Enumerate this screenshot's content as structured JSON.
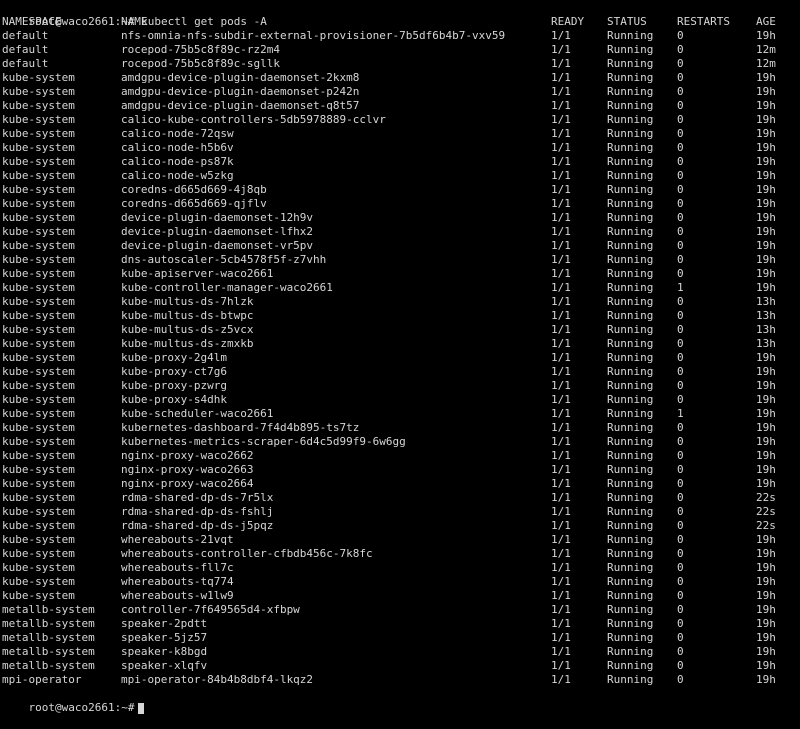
{
  "terminal": {
    "prompt_command": "root@waco2661:~# kubectl get pods -A",
    "final_prompt": "root@waco2661:~#",
    "headers": {
      "namespace": "NAMESPACE",
      "name": "NAME",
      "ready": "READY",
      "status": "STATUS",
      "restarts": "RESTARTS",
      "age": "AGE"
    },
    "rows": [
      {
        "namespace": "default",
        "name": "nfs-omnia-nfs-subdir-external-provisioner-7b5df6b4b7-vxv59",
        "ready": "1/1",
        "status": "Running",
        "restarts": "0",
        "age": "19h"
      },
      {
        "namespace": "default",
        "name": "rocepod-75b5c8f89c-rz2m4",
        "ready": "1/1",
        "status": "Running",
        "restarts": "0",
        "age": "12m"
      },
      {
        "namespace": "default",
        "name": "rocepod-75b5c8f89c-sgllk",
        "ready": "1/1",
        "status": "Running",
        "restarts": "0",
        "age": "12m"
      },
      {
        "namespace": "kube-system",
        "name": "amdgpu-device-plugin-daemonset-2kxm8",
        "ready": "1/1",
        "status": "Running",
        "restarts": "0",
        "age": "19h"
      },
      {
        "namespace": "kube-system",
        "name": "amdgpu-device-plugin-daemonset-p242n",
        "ready": "1/1",
        "status": "Running",
        "restarts": "0",
        "age": "19h"
      },
      {
        "namespace": "kube-system",
        "name": "amdgpu-device-plugin-daemonset-q8t57",
        "ready": "1/1",
        "status": "Running",
        "restarts": "0",
        "age": "19h"
      },
      {
        "namespace": "kube-system",
        "name": "calico-kube-controllers-5db5978889-cclvr",
        "ready": "1/1",
        "status": "Running",
        "restarts": "0",
        "age": "19h"
      },
      {
        "namespace": "kube-system",
        "name": "calico-node-72qsw",
        "ready": "1/1",
        "status": "Running",
        "restarts": "0",
        "age": "19h"
      },
      {
        "namespace": "kube-system",
        "name": "calico-node-h5b6v",
        "ready": "1/1",
        "status": "Running",
        "restarts": "0",
        "age": "19h"
      },
      {
        "namespace": "kube-system",
        "name": "calico-node-ps87k",
        "ready": "1/1",
        "status": "Running",
        "restarts": "0",
        "age": "19h"
      },
      {
        "namespace": "kube-system",
        "name": "calico-node-w5zkg",
        "ready": "1/1",
        "status": "Running",
        "restarts": "0",
        "age": "19h"
      },
      {
        "namespace": "kube-system",
        "name": "coredns-d665d669-4j8qb",
        "ready": "1/1",
        "status": "Running",
        "restarts": "0",
        "age": "19h"
      },
      {
        "namespace": "kube-system",
        "name": "coredns-d665d669-qjflv",
        "ready": "1/1",
        "status": "Running",
        "restarts": "0",
        "age": "19h"
      },
      {
        "namespace": "kube-system",
        "name": "device-plugin-daemonset-12h9v",
        "ready": "1/1",
        "status": "Running",
        "restarts": "0",
        "age": "19h"
      },
      {
        "namespace": "kube-system",
        "name": "device-plugin-daemonset-lfhx2",
        "ready": "1/1",
        "status": "Running",
        "restarts": "0",
        "age": "19h"
      },
      {
        "namespace": "kube-system",
        "name": "device-plugin-daemonset-vr5pv",
        "ready": "1/1",
        "status": "Running",
        "restarts": "0",
        "age": "19h"
      },
      {
        "namespace": "kube-system",
        "name": "dns-autoscaler-5cb4578f5f-z7vhh",
        "ready": "1/1",
        "status": "Running",
        "restarts": "0",
        "age": "19h"
      },
      {
        "namespace": "kube-system",
        "name": "kube-apiserver-waco2661",
        "ready": "1/1",
        "status": "Running",
        "restarts": "0",
        "age": "19h"
      },
      {
        "namespace": "kube-system",
        "name": "kube-controller-manager-waco2661",
        "ready": "1/1",
        "status": "Running",
        "restarts": "1",
        "age": "19h"
      },
      {
        "namespace": "kube-system",
        "name": "kube-multus-ds-7hlzk",
        "ready": "1/1",
        "status": "Running",
        "restarts": "0",
        "age": "13h"
      },
      {
        "namespace": "kube-system",
        "name": "kube-multus-ds-btwpc",
        "ready": "1/1",
        "status": "Running",
        "restarts": "0",
        "age": "13h"
      },
      {
        "namespace": "kube-system",
        "name": "kube-multus-ds-z5vcx",
        "ready": "1/1",
        "status": "Running",
        "restarts": "0",
        "age": "13h"
      },
      {
        "namespace": "kube-system",
        "name": "kube-multus-ds-zmxkb",
        "ready": "1/1",
        "status": "Running",
        "restarts": "0",
        "age": "13h"
      },
      {
        "namespace": "kube-system",
        "name": "kube-proxy-2g4lm",
        "ready": "1/1",
        "status": "Running",
        "restarts": "0",
        "age": "19h"
      },
      {
        "namespace": "kube-system",
        "name": "kube-proxy-ct7g6",
        "ready": "1/1",
        "status": "Running",
        "restarts": "0",
        "age": "19h"
      },
      {
        "namespace": "kube-system",
        "name": "kube-proxy-pzwrg",
        "ready": "1/1",
        "status": "Running",
        "restarts": "0",
        "age": "19h"
      },
      {
        "namespace": "kube-system",
        "name": "kube-proxy-s4dhk",
        "ready": "1/1",
        "status": "Running",
        "restarts": "0",
        "age": "19h"
      },
      {
        "namespace": "kube-system",
        "name": "kube-scheduler-waco2661",
        "ready": "1/1",
        "status": "Running",
        "restarts": "1",
        "age": "19h"
      },
      {
        "namespace": "kube-system",
        "name": "kubernetes-dashboard-7f4d4b895-ts7tz",
        "ready": "1/1",
        "status": "Running",
        "restarts": "0",
        "age": "19h"
      },
      {
        "namespace": "kube-system",
        "name": "kubernetes-metrics-scraper-6d4c5d99f9-6w6gg",
        "ready": "1/1",
        "status": "Running",
        "restarts": "0",
        "age": "19h"
      },
      {
        "namespace": "kube-system",
        "name": "nginx-proxy-waco2662",
        "ready": "1/1",
        "status": "Running",
        "restarts": "0",
        "age": "19h"
      },
      {
        "namespace": "kube-system",
        "name": "nginx-proxy-waco2663",
        "ready": "1/1",
        "status": "Running",
        "restarts": "0",
        "age": "19h"
      },
      {
        "namespace": "kube-system",
        "name": "nginx-proxy-waco2664",
        "ready": "1/1",
        "status": "Running",
        "restarts": "0",
        "age": "19h"
      },
      {
        "namespace": "kube-system",
        "name": "rdma-shared-dp-ds-7r5lx",
        "ready": "1/1",
        "status": "Running",
        "restarts": "0",
        "age": "22s"
      },
      {
        "namespace": "kube-system",
        "name": "rdma-shared-dp-ds-fshlj",
        "ready": "1/1",
        "status": "Running",
        "restarts": "0",
        "age": "22s"
      },
      {
        "namespace": "kube-system",
        "name": "rdma-shared-dp-ds-j5pqz",
        "ready": "1/1",
        "status": "Running",
        "restarts": "0",
        "age": "22s"
      },
      {
        "namespace": "kube-system",
        "name": "whereabouts-21vqt",
        "ready": "1/1",
        "status": "Running",
        "restarts": "0",
        "age": "19h"
      },
      {
        "namespace": "kube-system",
        "name": "whereabouts-controller-cfbdb456c-7k8fc",
        "ready": "1/1",
        "status": "Running",
        "restarts": "0",
        "age": "19h"
      },
      {
        "namespace": "kube-system",
        "name": "whereabouts-fll7c",
        "ready": "1/1",
        "status": "Running",
        "restarts": "0",
        "age": "19h"
      },
      {
        "namespace": "kube-system",
        "name": "whereabouts-tq774",
        "ready": "1/1",
        "status": "Running",
        "restarts": "0",
        "age": "19h"
      },
      {
        "namespace": "kube-system",
        "name": "whereabouts-w1lw9",
        "ready": "1/1",
        "status": "Running",
        "restarts": "0",
        "age": "19h"
      },
      {
        "namespace": "metallb-system",
        "name": "controller-7f649565d4-xfbpw",
        "ready": "1/1",
        "status": "Running",
        "restarts": "0",
        "age": "19h"
      },
      {
        "namespace": "metallb-system",
        "name": "speaker-2pdtt",
        "ready": "1/1",
        "status": "Running",
        "restarts": "0",
        "age": "19h"
      },
      {
        "namespace": "metallb-system",
        "name": "speaker-5jz57",
        "ready": "1/1",
        "status": "Running",
        "restarts": "0",
        "age": "19h"
      },
      {
        "namespace": "metallb-system",
        "name": "speaker-k8bgd",
        "ready": "1/1",
        "status": "Running",
        "restarts": "0",
        "age": "19h"
      },
      {
        "namespace": "metallb-system",
        "name": "speaker-xlqfv",
        "ready": "1/1",
        "status": "Running",
        "restarts": "0",
        "age": "19h"
      },
      {
        "namespace": "mpi-operator",
        "name": "mpi-operator-84b4b8dbf4-lkqz2",
        "ready": "1/1",
        "status": "Running",
        "restarts": "0",
        "age": "19h"
      }
    ],
    "colors": {
      "background": "#000000",
      "text": "#d6d6d6"
    }
  }
}
